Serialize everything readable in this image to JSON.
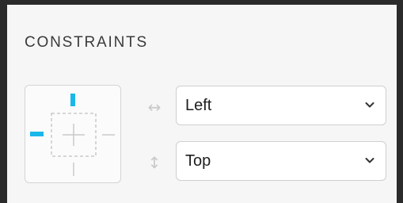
{
  "panel": {
    "title": "CONSTRAINTS"
  },
  "constraint_widget": {
    "active_color": "#1ab7ea",
    "inactive_color": "#c9c9c9",
    "active_sides": [
      "top",
      "left"
    ]
  },
  "horizontal": {
    "icon": "horizontal-arrows-icon",
    "icon_glyph": "↔",
    "selected": "Left"
  },
  "vertical": {
    "icon": "vertical-arrows-icon",
    "icon_glyph": "↕",
    "selected": "Top"
  }
}
